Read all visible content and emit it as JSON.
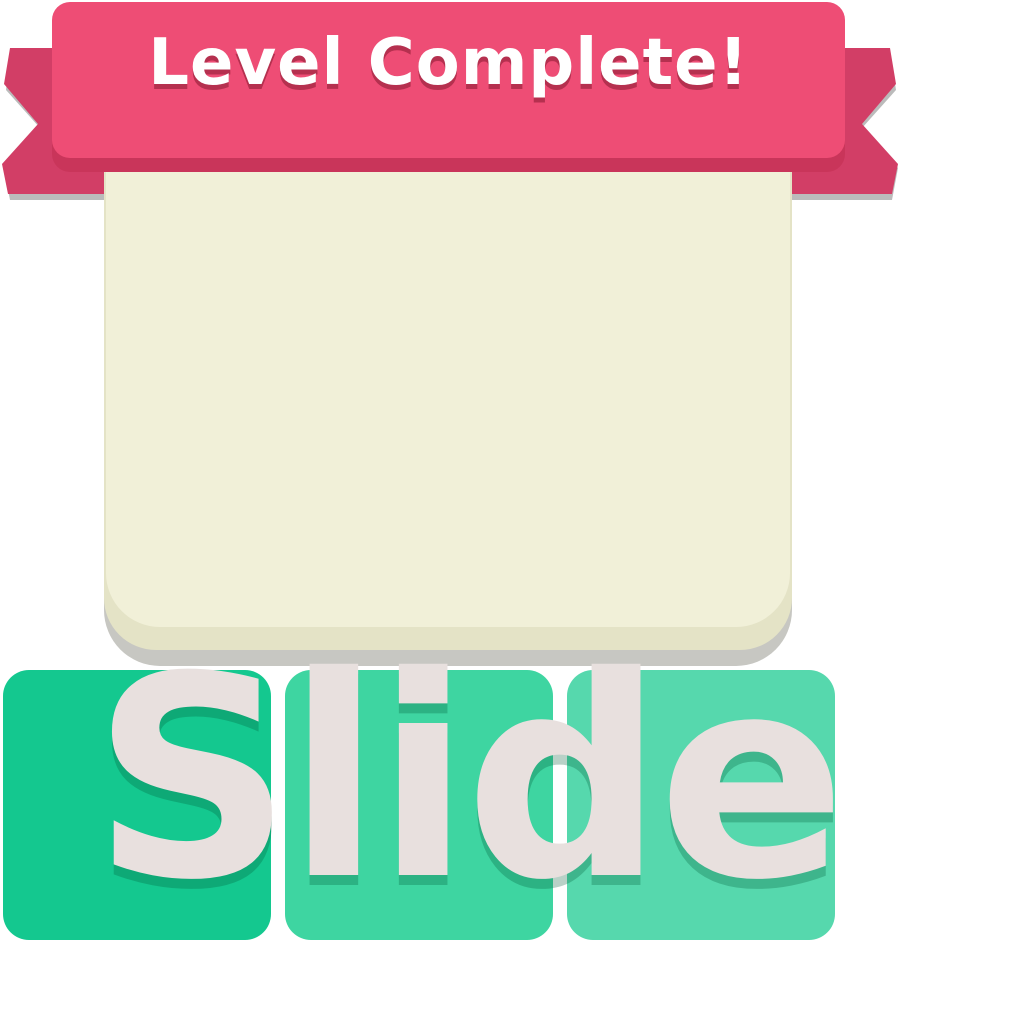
{
  "banner": {
    "title": "Level Complete!"
  },
  "logo": {
    "word": "Slide"
  },
  "colors": {
    "ribbon": "#ee4d75",
    "ribbon_dark": "#c9355a",
    "panel": "#f1f0d8",
    "tile_1": "#14c88f",
    "tile_2": "#3ed5a1",
    "tile_3": "#56d8ad",
    "logo_text": "#e8e0de"
  }
}
